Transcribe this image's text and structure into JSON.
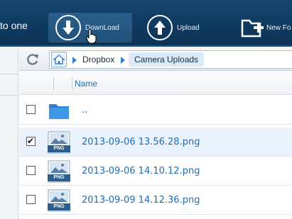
{
  "toolbar": {
    "left_text": "to one",
    "download_label": "DownLoad",
    "upload_label": "Upload",
    "new_folder_label": "New Fo"
  },
  "breadcrumb": {
    "items": [
      "Dropbox",
      "Camera Uploads"
    ]
  },
  "table": {
    "name_header": "Name"
  },
  "files": [
    {
      "name": "..",
      "type": "folder",
      "checked": false
    },
    {
      "name": "2013-09-06 13.56.28.png",
      "type": "png",
      "checked": true
    },
    {
      "name": "2013-09-06 14.10.12.png",
      "type": "png",
      "checked": false
    },
    {
      "name": "2013-09-09 14.12.36.png",
      "type": "png",
      "checked": false
    }
  ],
  "icons": {
    "png_badge": "PNG"
  },
  "colors": {
    "toolbar_bg": "#0f3a60",
    "link_blue": "#1f6db3",
    "selected_row": "#eaf3fb"
  }
}
